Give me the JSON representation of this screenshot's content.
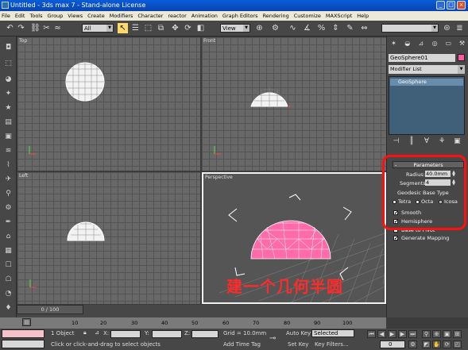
{
  "window": {
    "title": "Untitled - 3ds max 7 - Stand-alone License"
  },
  "menu": [
    "File",
    "Edit",
    "Tools",
    "Group",
    "Views",
    "Create",
    "Modifiers",
    "Character",
    "reactor",
    "Animation",
    "Graph Editors",
    "Rendering",
    "Customize",
    "MAXScript",
    "Help"
  ],
  "toolbar": {
    "selection_filter": "All",
    "ref_coord": "View",
    "named_selection": ""
  },
  "viewports": {
    "top": "Top",
    "front": "Front",
    "left": "Left",
    "perspective": "Perspective"
  },
  "caption": "建一个几何半圆",
  "command_panel": {
    "object_name": "GeoSphere01",
    "object_color": "#ff5aa0",
    "modifier_list": "Modifier List",
    "stack_item": "GeoSphere",
    "parameters": {
      "title": "Parameters",
      "radius_label": "Radius:",
      "radius": "40.0mm",
      "segments_label": "Segments:",
      "segments": "4",
      "base_type_label": "Geodesic Base Type",
      "base_types": [
        "Tetra",
        "Octa",
        "Icosa"
      ],
      "selected_base_type": "Icosa",
      "smooth": "Smooth",
      "hemisphere": "Hemisphere",
      "base_to_pivot": "Base to Pivot",
      "generate_mapping": "Generate Mapping"
    }
  },
  "timeline": {
    "frame_display": "0 / 100",
    "ticks": [
      "10",
      "20",
      "30",
      "40",
      "50",
      "60",
      "70",
      "80",
      "90",
      "100"
    ]
  },
  "status": {
    "selection_info": "1 Object",
    "x_label": "X:",
    "y_label": "Y:",
    "z_label": "Z:",
    "grid": "Grid = 10.0mm",
    "prompt": "Click or click-and-drag to select objects",
    "add_time_tag": "Add Time Tag",
    "auto_key": "Auto Key",
    "auto_key_selection": "Selected",
    "set_key": "Set Key",
    "key_filters": "Key Filters...",
    "current_frame": "0"
  },
  "colors": {
    "highlight_outline": "#ff1010",
    "caption": "#ff2a2a",
    "hemisphere_fill": "#ff5aa0"
  }
}
